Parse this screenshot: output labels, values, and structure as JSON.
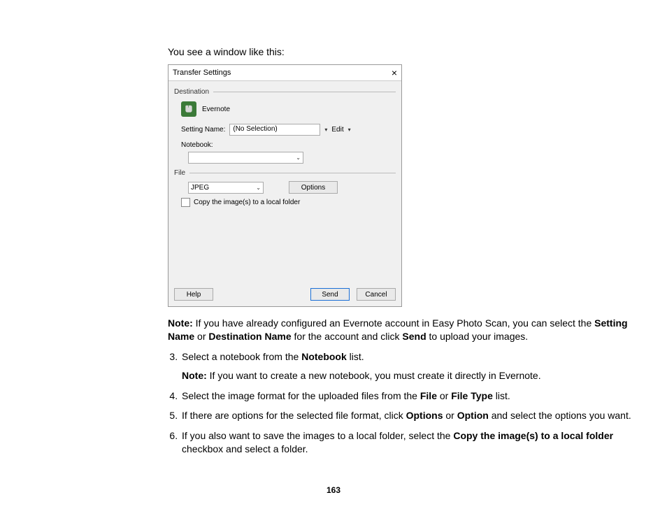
{
  "intro": "You see a window like this:",
  "dialog": {
    "title": "Transfer Settings",
    "close_glyph": "×",
    "destination": {
      "legend": "Destination",
      "service": "Evernote",
      "setting_name_label": "Setting Name:",
      "setting_name_value": "(No Selection)",
      "edit_label": "Edit",
      "notebook_label": "Notebook:",
      "notebook_value": ""
    },
    "file": {
      "legend": "File",
      "format_value": "JPEG",
      "options_label": "Options",
      "copy_label": "Copy the image(s) to a local folder"
    },
    "buttons": {
      "help": "Help",
      "send": "Send",
      "cancel": "Cancel"
    }
  },
  "note1": {
    "label": "Note:",
    "t1": " If you have already configured an Evernote account in Easy Photo Scan, you can select the ",
    "b1": "Setting Name",
    "t2": " or ",
    "b2": "Destination Name",
    "t3": " for the account and click ",
    "b3": "Send",
    "t4": " to upload your images."
  },
  "steps": {
    "s3": {
      "t1": "Select a notebook from the ",
      "b1": "Notebook",
      "t2": " list."
    },
    "s3note": {
      "label": "Note:",
      "text": " If you want to create a new notebook, you must create it directly in Evernote."
    },
    "s4": {
      "t1": "Select the image format for the uploaded files from the ",
      "b1": "File",
      "t2": " or ",
      "b2": "File Type",
      "t3": " list."
    },
    "s5": {
      "t1": "If there are options for the selected file format, click ",
      "b1": "Options",
      "t2": " or ",
      "b2": "Option",
      "t3": " and select the options you want."
    },
    "s6": {
      "t1": "If you also want to save the images to a local folder, select the ",
      "b1": "Copy the image(s) to a local folder",
      "t2": " checkbox and select a folder."
    }
  },
  "page_number": "163"
}
